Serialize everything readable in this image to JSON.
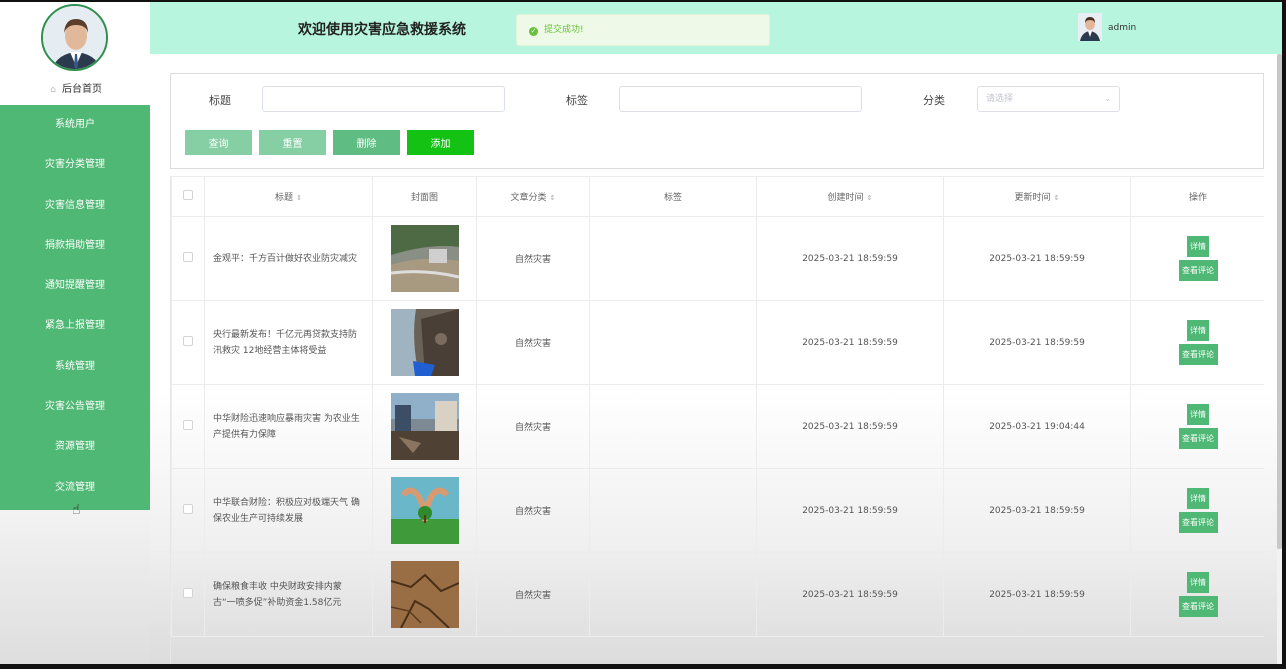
{
  "sidebar": {
    "home": "后台首页",
    "items": [
      "系统用户",
      "灾害分类管理",
      "灾害信息管理",
      "捐款捐助管理",
      "通知提醒管理",
      "紧急上报管理",
      "系统管理",
      "灾害公告管理",
      "资源管理",
      "交流管理"
    ]
  },
  "header": {
    "title": "欢迎使用灾害应急救援系统",
    "toast": "提交成功!",
    "username": "admin"
  },
  "search": {
    "title_label": "标题",
    "tag_label": "标签",
    "category_label": "分类",
    "category_placeholder": "请选择",
    "query": "查询",
    "reset": "重置",
    "delete": "删除",
    "add": "添加"
  },
  "table": {
    "headers": {
      "title": "标题",
      "cover": "封面图",
      "category": "文章分类",
      "tag": "标签",
      "created": "创建时间",
      "updated": "更新时间",
      "ops": "操作"
    },
    "actions": {
      "detail": "详情",
      "comment": "查看评论"
    },
    "rows": [
      {
        "title": "金观平：千方百计做好农业防灾减灾",
        "category": "自然灾害",
        "tag": "",
        "created": "2025-03-21 18:59:59",
        "updated": "2025-03-21 18:59:59"
      },
      {
        "title": "央行最新发布！千亿元再贷款支持防汛救灾 12地经营主体将受益",
        "category": "自然灾害",
        "tag": "",
        "created": "2025-03-21 18:59:59",
        "updated": "2025-03-21 18:59:59"
      },
      {
        "title": "中华财险迅速响应暴雨灾害 为农业生产提供有力保障",
        "category": "自然灾害",
        "tag": "",
        "created": "2025-03-21 18:59:59",
        "updated": "2025-03-21 19:04:44"
      },
      {
        "title": "中华联合财险：积极应对极端天气 确保农业生产可持续发展",
        "category": "自然灾害",
        "tag": "",
        "created": "2025-03-21 18:59:59",
        "updated": "2025-03-21 18:59:59"
      },
      {
        "title": "确保粮食丰收 中央财政安排内蒙古“一喷多促”补助资金1.58亿元",
        "category": "自然灾害",
        "tag": "",
        "created": "2025-03-21 18:59:59",
        "updated": "2025-03-21 18:59:59"
      }
    ]
  }
}
